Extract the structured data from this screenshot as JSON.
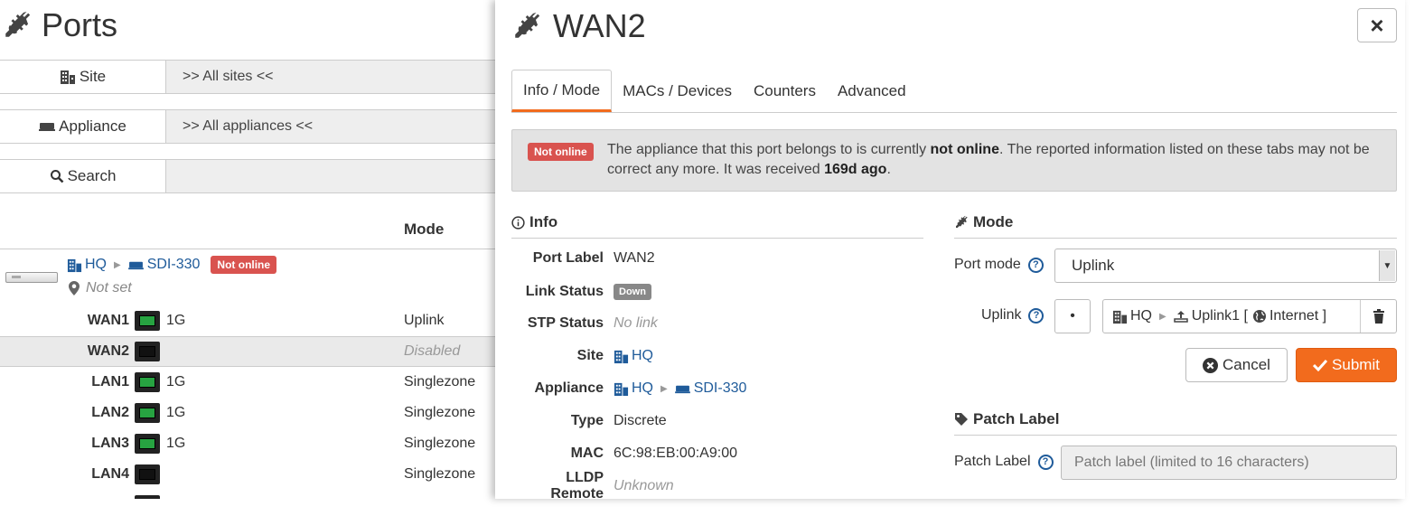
{
  "left": {
    "title": "Ports",
    "filters": [
      {
        "label": "Site",
        "value": ">> All sites <<",
        "icon": "building-icon"
      },
      {
        "label": "Appliance",
        "value": ">> All appliances <<",
        "icon": "appliance-icon"
      },
      {
        "label": "Search",
        "value": "",
        "icon": "search-icon"
      }
    ],
    "column_mode": "Mode",
    "appliance": {
      "site": "HQ",
      "name": "SDI-330",
      "status_badge": "Not online",
      "location": "Not set"
    },
    "ports": [
      {
        "name": "WAN1",
        "speed": "1G",
        "mode": "Uplink",
        "link": "up"
      },
      {
        "name": "WAN2",
        "speed": "",
        "mode": "Disabled",
        "link": "down"
      },
      {
        "name": "LAN1",
        "speed": "1G",
        "mode": "Singlezone",
        "link": "up"
      },
      {
        "name": "LAN2",
        "speed": "1G",
        "mode": "Singlezone",
        "link": "up"
      },
      {
        "name": "LAN3",
        "speed": "1G",
        "mode": "Singlezone",
        "link": "up"
      },
      {
        "name": "LAN4",
        "speed": "",
        "mode": "Singlezone",
        "link": "down"
      }
    ]
  },
  "panel": {
    "title": "WAN2",
    "close_label": "×",
    "tabs": [
      "Info / Mode",
      "MACs / Devices",
      "Counters",
      "Advanced"
    ],
    "alert": {
      "badge": "Not online",
      "text_1": "The appliance that this port belongs to is currently ",
      "bold_1": "not online",
      "text_2": ". The reported information listed on these tabs may not be correct any more. It was received ",
      "bold_2": "169d ago",
      "text_3": "."
    },
    "info": {
      "heading": "Info",
      "port_label_key": "Port Label",
      "port_label_value": "WAN2",
      "link_status_key": "Link Status",
      "link_status_value": "Down",
      "stp_status_key": "STP Status",
      "stp_status_value": "No link",
      "site_key": "Site",
      "site_value": "HQ",
      "appliance_key": "Appliance",
      "appliance_site": "HQ",
      "appliance_name": "SDI-330",
      "type_key": "Type",
      "type_value": "Discrete",
      "mac_key": "MAC",
      "mac_value": "6C:98:EB:00:A9:00",
      "lldp_key": "LLDP Remote",
      "lldp_value": "Unknown"
    },
    "mode": {
      "heading": "Mode",
      "port_mode_label": "Port mode",
      "port_mode_value": "Uplink",
      "uplink_label": "Uplink",
      "uplink_site": "HQ",
      "uplink_name": "Uplink1 [",
      "uplink_network": "Internet ]",
      "dot_label": "•",
      "cancel_label": "Cancel",
      "submit_label": "Submit"
    },
    "patch": {
      "heading": "Patch Label",
      "label": "Patch Label",
      "placeholder": "Patch label (limited to 16 characters)"
    }
  },
  "colors": {
    "accent": "#f26b1d",
    "link": "#1f5b9a",
    "danger": "#d9534f",
    "port_up": "#27a341"
  }
}
